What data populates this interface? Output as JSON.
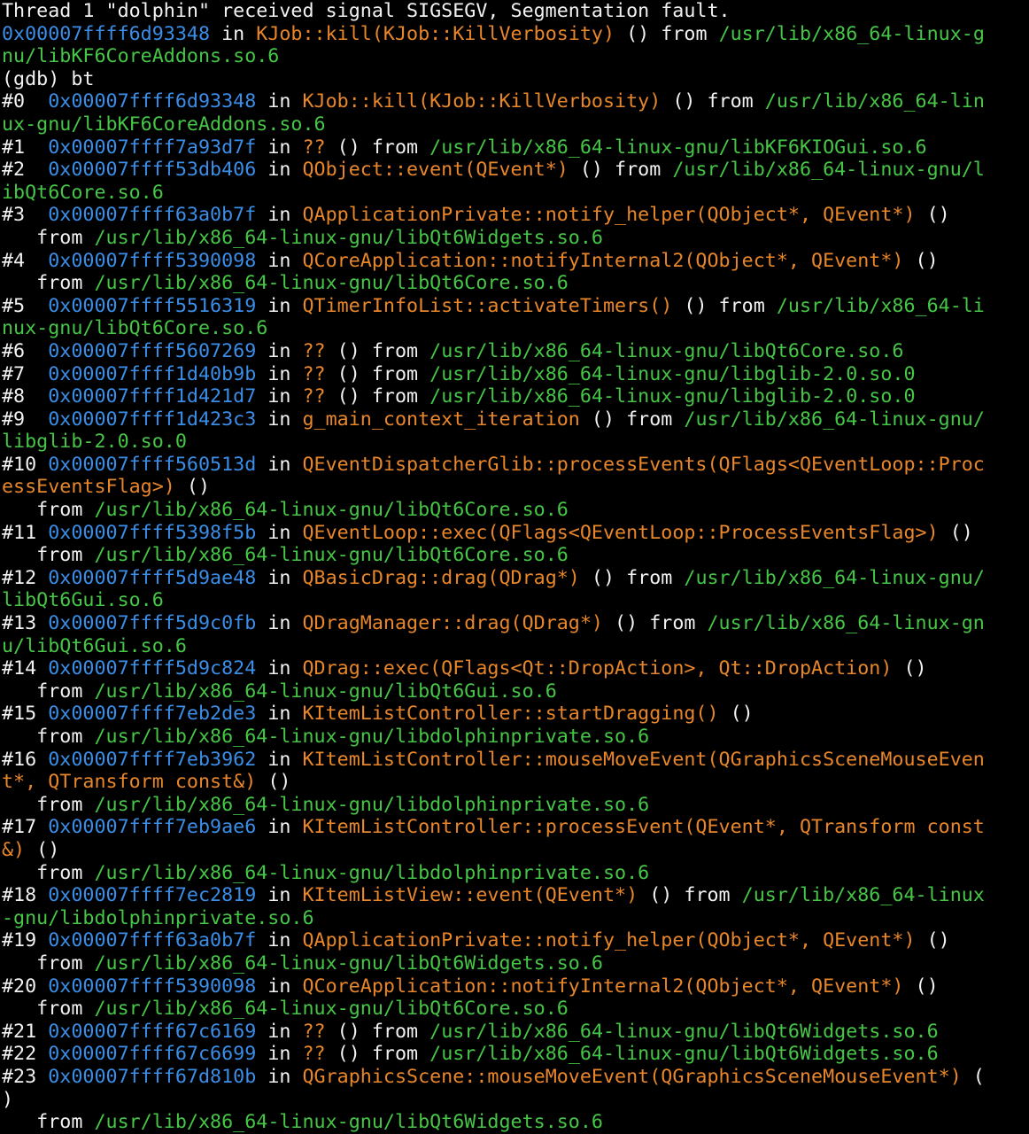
{
  "colors": {
    "background": "#000000",
    "text": "#f2f2f2",
    "address": "#3b8ee8",
    "function": "#e8862a",
    "path": "#46c646"
  },
  "lines": [
    [
      {
        "t": "plain",
        "v": "Thread 1 \"dolphin\" received signal SIGSEGV, Segmentation fault."
      }
    ],
    [
      {
        "t": "addr",
        "v": "0x00007ffff6d93348"
      },
      {
        "t": "plain",
        "v": " in "
      },
      {
        "t": "func",
        "v": "KJob::kill(KJob::KillVerbosity)"
      },
      {
        "t": "plain",
        "v": " () from "
      },
      {
        "t": "path",
        "v": "/usr/lib/x86_64-linux-g"
      }
    ],
    [
      {
        "t": "path",
        "v": "nu/libKF6CoreAddons.so.6"
      }
    ],
    [
      {
        "t": "plain",
        "v": "(gdb) bt"
      }
    ],
    [
      {
        "t": "plain",
        "v": "#0  "
      },
      {
        "t": "addr",
        "v": "0x00007ffff6d93348"
      },
      {
        "t": "plain",
        "v": " in "
      },
      {
        "t": "func",
        "v": "KJob::kill(KJob::KillVerbosity)"
      },
      {
        "t": "plain",
        "v": " () from "
      },
      {
        "t": "path",
        "v": "/usr/lib/x86_64-lin"
      }
    ],
    [
      {
        "t": "path",
        "v": "ux-gnu/libKF6CoreAddons.so.6"
      }
    ],
    [
      {
        "t": "plain",
        "v": "#1  "
      },
      {
        "t": "addr",
        "v": "0x00007ffff7a93d7f"
      },
      {
        "t": "plain",
        "v": " in "
      },
      {
        "t": "func",
        "v": "??"
      },
      {
        "t": "plain",
        "v": " () from "
      },
      {
        "t": "path",
        "v": "/usr/lib/x86_64-linux-gnu/libKF6KIOGui.so.6"
      }
    ],
    [
      {
        "t": "plain",
        "v": "#2  "
      },
      {
        "t": "addr",
        "v": "0x00007ffff53db406"
      },
      {
        "t": "plain",
        "v": " in "
      },
      {
        "t": "func",
        "v": "QObject::event(QEvent*)"
      },
      {
        "t": "plain",
        "v": " () from "
      },
      {
        "t": "path",
        "v": "/usr/lib/x86_64-linux-gnu/l"
      }
    ],
    [
      {
        "t": "path",
        "v": "ibQt6Core.so.6"
      }
    ],
    [
      {
        "t": "plain",
        "v": "#3  "
      },
      {
        "t": "addr",
        "v": "0x00007ffff63a0b7f"
      },
      {
        "t": "plain",
        "v": " in "
      },
      {
        "t": "func",
        "v": "QApplicationPrivate::notify_helper(QObject*, QEvent*)"
      },
      {
        "t": "plain",
        "v": " ()"
      }
    ],
    [
      {
        "t": "plain",
        "v": "   from "
      },
      {
        "t": "path",
        "v": "/usr/lib/x86_64-linux-gnu/libQt6Widgets.so.6"
      }
    ],
    [
      {
        "t": "plain",
        "v": "#4  "
      },
      {
        "t": "addr",
        "v": "0x00007ffff5390098"
      },
      {
        "t": "plain",
        "v": " in "
      },
      {
        "t": "func",
        "v": "QCoreApplication::notifyInternal2(QObject*, QEvent*)"
      },
      {
        "t": "plain",
        "v": " ()"
      }
    ],
    [
      {
        "t": "plain",
        "v": "   from "
      },
      {
        "t": "path",
        "v": "/usr/lib/x86_64-linux-gnu/libQt6Core.so.6"
      }
    ],
    [
      {
        "t": "plain",
        "v": "#5  "
      },
      {
        "t": "addr",
        "v": "0x00007ffff5516319"
      },
      {
        "t": "plain",
        "v": " in "
      },
      {
        "t": "func",
        "v": "QTimerInfoList::activateTimers()"
      },
      {
        "t": "plain",
        "v": " () from "
      },
      {
        "t": "path",
        "v": "/usr/lib/x86_64-li"
      }
    ],
    [
      {
        "t": "path",
        "v": "nux-gnu/libQt6Core.so.6"
      }
    ],
    [
      {
        "t": "plain",
        "v": "#6  "
      },
      {
        "t": "addr",
        "v": "0x00007ffff5607269"
      },
      {
        "t": "plain",
        "v": " in "
      },
      {
        "t": "func",
        "v": "??"
      },
      {
        "t": "plain",
        "v": " () from "
      },
      {
        "t": "path",
        "v": "/usr/lib/x86_64-linux-gnu/libQt6Core.so.6"
      }
    ],
    [
      {
        "t": "plain",
        "v": "#7  "
      },
      {
        "t": "addr",
        "v": "0x00007ffff1d40b9b"
      },
      {
        "t": "plain",
        "v": " in "
      },
      {
        "t": "func",
        "v": "??"
      },
      {
        "t": "plain",
        "v": " () from "
      },
      {
        "t": "path",
        "v": "/usr/lib/x86_64-linux-gnu/libglib-2.0.so.0"
      }
    ],
    [
      {
        "t": "plain",
        "v": "#8  "
      },
      {
        "t": "addr",
        "v": "0x00007ffff1d421d7"
      },
      {
        "t": "plain",
        "v": " in "
      },
      {
        "t": "func",
        "v": "??"
      },
      {
        "t": "plain",
        "v": " () from "
      },
      {
        "t": "path",
        "v": "/usr/lib/x86_64-linux-gnu/libglib-2.0.so.0"
      }
    ],
    [
      {
        "t": "plain",
        "v": "#9  "
      },
      {
        "t": "addr",
        "v": "0x00007ffff1d423c3"
      },
      {
        "t": "plain",
        "v": " in "
      },
      {
        "t": "func",
        "v": "g_main_context_iteration"
      },
      {
        "t": "plain",
        "v": " () from "
      },
      {
        "t": "path",
        "v": "/usr/lib/x86_64-linux-gnu/"
      }
    ],
    [
      {
        "t": "path",
        "v": "libglib-2.0.so.0"
      }
    ],
    [
      {
        "t": "plain",
        "v": "#10 "
      },
      {
        "t": "addr",
        "v": "0x00007ffff560513d"
      },
      {
        "t": "plain",
        "v": " in "
      },
      {
        "t": "func",
        "v": "QEventDispatcherGlib::processEvents(QFlags<QEventLoop::Proc"
      }
    ],
    [
      {
        "t": "func",
        "v": "essEventsFlag>)"
      },
      {
        "t": "plain",
        "v": " ()"
      }
    ],
    [
      {
        "t": "plain",
        "v": "   from "
      },
      {
        "t": "path",
        "v": "/usr/lib/x86_64-linux-gnu/libQt6Core.so.6"
      }
    ],
    [
      {
        "t": "plain",
        "v": "#11 "
      },
      {
        "t": "addr",
        "v": "0x00007ffff5398f5b"
      },
      {
        "t": "plain",
        "v": " in "
      },
      {
        "t": "func",
        "v": "QEventLoop::exec(QFlags<QEventLoop::ProcessEventsFlag>)"
      },
      {
        "t": "plain",
        "v": " ()"
      }
    ],
    [
      {
        "t": "plain",
        "v": "   from "
      },
      {
        "t": "path",
        "v": "/usr/lib/x86_64-linux-gnu/libQt6Core.so.6"
      }
    ],
    [
      {
        "t": "plain",
        "v": "#12 "
      },
      {
        "t": "addr",
        "v": "0x00007ffff5d9ae48"
      },
      {
        "t": "plain",
        "v": " in "
      },
      {
        "t": "func",
        "v": "QBasicDrag::drag(QDrag*)"
      },
      {
        "t": "plain",
        "v": " () from "
      },
      {
        "t": "path",
        "v": "/usr/lib/x86_64-linux-gnu/"
      }
    ],
    [
      {
        "t": "path",
        "v": "libQt6Gui.so.6"
      }
    ],
    [
      {
        "t": "plain",
        "v": "#13 "
      },
      {
        "t": "addr",
        "v": "0x00007ffff5d9c0fb"
      },
      {
        "t": "plain",
        "v": " in "
      },
      {
        "t": "func",
        "v": "QDragManager::drag(QDrag*)"
      },
      {
        "t": "plain",
        "v": " () from "
      },
      {
        "t": "path",
        "v": "/usr/lib/x86_64-linux-gn"
      }
    ],
    [
      {
        "t": "path",
        "v": "u/libQt6Gui.so.6"
      }
    ],
    [
      {
        "t": "plain",
        "v": "#14 "
      },
      {
        "t": "addr",
        "v": "0x00007ffff5d9c824"
      },
      {
        "t": "plain",
        "v": " in "
      },
      {
        "t": "func",
        "v": "QDrag::exec(QFlags<Qt::DropAction>, Qt::DropAction)"
      },
      {
        "t": "plain",
        "v": " ()"
      }
    ],
    [
      {
        "t": "plain",
        "v": "   from "
      },
      {
        "t": "path",
        "v": "/usr/lib/x86_64-linux-gnu/libQt6Gui.so.6"
      }
    ],
    [
      {
        "t": "plain",
        "v": "#15 "
      },
      {
        "t": "addr",
        "v": "0x00007ffff7eb2de3"
      },
      {
        "t": "plain",
        "v": " in "
      },
      {
        "t": "func",
        "v": "KItemListController::startDragging()"
      },
      {
        "t": "plain",
        "v": " ()"
      }
    ],
    [
      {
        "t": "plain",
        "v": "   from "
      },
      {
        "t": "path",
        "v": "/usr/lib/x86_64-linux-gnu/libdolphinprivate.so.6"
      }
    ],
    [
      {
        "t": "plain",
        "v": "#16 "
      },
      {
        "t": "addr",
        "v": "0x00007ffff7eb3962"
      },
      {
        "t": "plain",
        "v": " in "
      },
      {
        "t": "func",
        "v": "KItemListController::mouseMoveEvent(QGraphicsSceneMouseEven"
      }
    ],
    [
      {
        "t": "func",
        "v": "t*, QTransform const&)"
      },
      {
        "t": "plain",
        "v": " ()"
      }
    ],
    [
      {
        "t": "plain",
        "v": "   from "
      },
      {
        "t": "path",
        "v": "/usr/lib/x86_64-linux-gnu/libdolphinprivate.so.6"
      }
    ],
    [
      {
        "t": "plain",
        "v": "#17 "
      },
      {
        "t": "addr",
        "v": "0x00007ffff7eb9ae6"
      },
      {
        "t": "plain",
        "v": " in "
      },
      {
        "t": "func",
        "v": "KItemListController::processEvent(QEvent*, QTransform const"
      }
    ],
    [
      {
        "t": "func",
        "v": "&)"
      },
      {
        "t": "plain",
        "v": " ()"
      }
    ],
    [
      {
        "t": "plain",
        "v": "   from "
      },
      {
        "t": "path",
        "v": "/usr/lib/x86_64-linux-gnu/libdolphinprivate.so.6"
      }
    ],
    [
      {
        "t": "plain",
        "v": "#18 "
      },
      {
        "t": "addr",
        "v": "0x00007ffff7ec2819"
      },
      {
        "t": "plain",
        "v": " in "
      },
      {
        "t": "func",
        "v": "KItemListView::event(QEvent*)"
      },
      {
        "t": "plain",
        "v": " () from "
      },
      {
        "t": "path",
        "v": "/usr/lib/x86_64-linux"
      }
    ],
    [
      {
        "t": "path",
        "v": "-gnu/libdolphinprivate.so.6"
      }
    ],
    [
      {
        "t": "plain",
        "v": "#19 "
      },
      {
        "t": "addr",
        "v": "0x00007ffff63a0b7f"
      },
      {
        "t": "plain",
        "v": " in "
      },
      {
        "t": "func",
        "v": "QApplicationPrivate::notify_helper(QObject*, QEvent*)"
      },
      {
        "t": "plain",
        "v": " ()"
      }
    ],
    [
      {
        "t": "plain",
        "v": "   from "
      },
      {
        "t": "path",
        "v": "/usr/lib/x86_64-linux-gnu/libQt6Widgets.so.6"
      }
    ],
    [
      {
        "t": "plain",
        "v": "#20 "
      },
      {
        "t": "addr",
        "v": "0x00007ffff5390098"
      },
      {
        "t": "plain",
        "v": " in "
      },
      {
        "t": "func",
        "v": "QCoreApplication::notifyInternal2(QObject*, QEvent*)"
      },
      {
        "t": "plain",
        "v": " ()"
      }
    ],
    [
      {
        "t": "plain",
        "v": "   from "
      },
      {
        "t": "path",
        "v": "/usr/lib/x86_64-linux-gnu/libQt6Core.so.6"
      }
    ],
    [
      {
        "t": "plain",
        "v": "#21 "
      },
      {
        "t": "addr",
        "v": "0x00007ffff67c6169"
      },
      {
        "t": "plain",
        "v": " in "
      },
      {
        "t": "func",
        "v": "??"
      },
      {
        "t": "plain",
        "v": " () from "
      },
      {
        "t": "path",
        "v": "/usr/lib/x86_64-linux-gnu/libQt6Widgets.so.6"
      }
    ],
    [
      {
        "t": "plain",
        "v": "#22 "
      },
      {
        "t": "addr",
        "v": "0x00007ffff67c6699"
      },
      {
        "t": "plain",
        "v": " in "
      },
      {
        "t": "func",
        "v": "??"
      },
      {
        "t": "plain",
        "v": " () from "
      },
      {
        "t": "path",
        "v": "/usr/lib/x86_64-linux-gnu/libQt6Widgets.so.6"
      }
    ],
    [
      {
        "t": "plain",
        "v": "#23 "
      },
      {
        "t": "addr",
        "v": "0x00007ffff67d810b"
      },
      {
        "t": "plain",
        "v": " in "
      },
      {
        "t": "func",
        "v": "QGraphicsScene::mouseMoveEvent(QGraphicsSceneMouseEvent*)"
      },
      {
        "t": "plain",
        "v": " ("
      }
    ],
    [
      {
        "t": "plain",
        "v": ")"
      }
    ],
    [
      {
        "t": "plain",
        "v": "   from "
      },
      {
        "t": "path",
        "v": "/usr/lib/x86_64-linux-gnu/libQt6Widgets.so.6"
      }
    ]
  ]
}
